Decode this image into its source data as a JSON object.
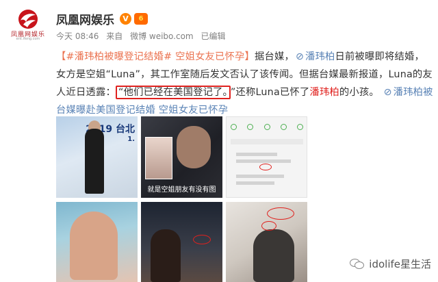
{
  "account": {
    "name": "凤凰网娱乐",
    "logo_text": "凤凰网娱乐",
    "logo_sub": "ent.ifeng.com",
    "verified_icon": "verified-v-icon",
    "vip_icon": "vip-level-icon",
    "vip_label": "6"
  },
  "meta": {
    "time": "今天 08:46",
    "source_prefix": "来自",
    "source": "微博 weibo.com",
    "edited": "已编辑"
  },
  "post": {
    "tag1": "【#潘玮柏被曝登记结婚# 空姐女友已怀孕】",
    "t1": "据台媒，",
    "mention": "潘玮柏",
    "t2": "日前被曝即将结婚，女方是空姐“Luna”，其工作室随后发文否认了该传闻。但据台媒最新报道，Luna的友人近日透露：",
    "quote": "“他们已经在美国登记了。",
    "t3": "”还称Luna已怀了",
    "name_red": "潘玮柏",
    "t4": "的小孩。",
    "link": "潘玮柏被台媒曝赴美国登记结婚 空姐女友已怀孕",
    "link_icon": "link-icon"
  },
  "images": {
    "t1_title": "2019 台北",
    "t1_sub": "1.",
    "t2_caption": "就是空姐朋友有没有图"
  },
  "watermark": {
    "icon": "wechat-icon",
    "text": "idolife星生活"
  }
}
